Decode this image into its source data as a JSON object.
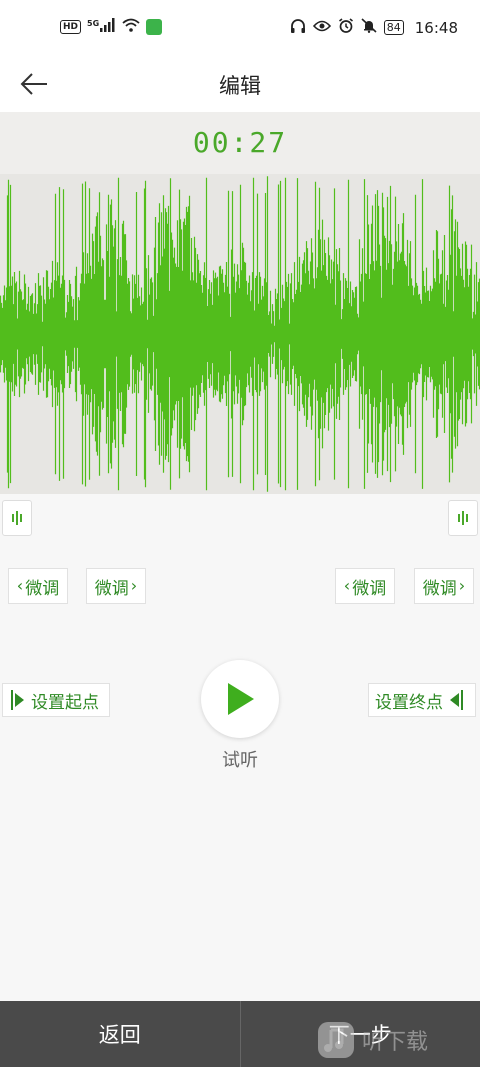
{
  "status_bar": {
    "hd": "HD",
    "network": "5G",
    "battery": "84",
    "time": "16:48"
  },
  "header": {
    "title": "编辑"
  },
  "editor": {
    "timer": "00:27",
    "wave_color": "#52bd1c",
    "fine_left_back": "微调",
    "fine_left_forward": "微调",
    "fine_right_back": "微调",
    "fine_right_forward": "微调",
    "set_start": "设置起点",
    "set_end": "设置终点",
    "listen": "试听"
  },
  "bottom": {
    "back": "返回",
    "next": "下一步"
  },
  "watermark": {
    "text": "听下载"
  }
}
